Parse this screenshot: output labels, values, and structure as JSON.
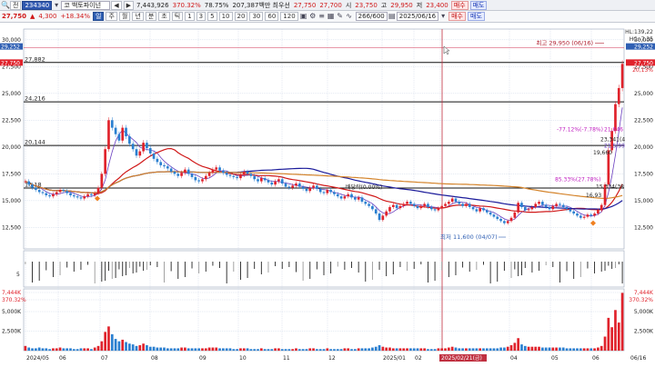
{
  "toolbar1": {
    "code_field": "",
    "code_value": "234340",
    "stock_name": "코 백토파이넌",
    "arrows": [
      "◀",
      "▶"
    ],
    "volume": "7,443,926",
    "vol_ratio": "370.32%",
    "turnover": "78.75%",
    "shares_info": "207,387백만 최우선",
    "bid1": "27,750",
    "bid2": "27,700",
    "open_label": "시",
    "open_value": "23,750",
    "high_label": "고",
    "high_value": "29,950",
    "low_label": "저",
    "low_value": "23,400",
    "buy_label": "매수",
    "sell_label": "매도"
  },
  "toolbar2": {
    "price": "27,750",
    "change_arrow": "▲",
    "change": "4,300",
    "change_pct": "+18.34%",
    "periods": [
      "주",
      "월",
      "년",
      "분",
      "초",
      "틱"
    ],
    "minutes": [
      "1",
      "3",
      "5",
      "10",
      "20",
      "30",
      "60",
      "120"
    ],
    "count": "266/600",
    "date": "2025/06/16",
    "buy_label": "매수",
    "sell_label": "매도"
  },
  "colors": {
    "up": "#e0222b",
    "down": "#2a7fd0",
    "ma5": "#6a3fc0",
    "ma20": "#d01818",
    "ma60": "#1a1a9a",
    "ma120": "#d4832a",
    "grid": "#c9d4e6",
    "level_line": "#111111",
    "cursor_line": "#c03040",
    "volume_bar": "#222222",
    "accent_blue": "#2f5fb3"
  },
  "chart_data": {
    "type": "candlestick",
    "y_axis_ticks": [
      "30,000",
      "27,500",
      "25,000",
      "22,500",
      "20,000",
      "17,500",
      "15,000",
      "12,500"
    ],
    "y_range": [
      10500,
      31000
    ],
    "x_axis_labels": [
      "2024/05",
      "06",
      "07",
      "08",
      "09",
      "10",
      "11",
      "12",
      "2025/01",
      "02",
      "2025/02/21(금)",
      "04",
      "05",
      "06",
      "06/16"
    ],
    "left_axis_tags": [
      "29,252",
      "27,750"
    ],
    "right_axis_tags": [
      "HL:139,22",
      "HC:-7.35",
      "29,252",
      "27,750",
      "20,13%"
    ],
    "left_levels": [
      "27,882",
      "24,216",
      "20,144",
      "16,18"
    ],
    "level_values": [
      27882,
      24216,
      20144,
      16180
    ],
    "annotations": {
      "high": "최고 29,950 (06/16)",
      "low": "최저 11,600 (04/07)",
      "pct1": "-77.12%(-7.78%)",
      "pct1_value": "21,646",
      "pct2": "85.33%(27.78%)",
      "pct2_value": "15,334(38",
      "mid1": "23,341(4",
      "mid2": "19,660",
      "mid3": "16,93",
      "mid4": "21,5.99",
      "mid_text": "배당락(0.00%)"
    },
    "sub1_axis": [
      "5"
    ],
    "sub2_axis_left": [
      "7,444K",
      "370.32%",
      "5,000K",
      "2,500K"
    ],
    "sub2_axis_right": [
      "7,444K",
      "370.32%",
      "5,000K",
      "2,500K"
    ],
    "price_series": [
      16800,
      16500,
      16200,
      16000,
      15800,
      15700,
      15500,
      15400,
      15600,
      15800,
      16000,
      15900,
      15700,
      15500,
      15400,
      15300,
      15200,
      15400,
      15600,
      15500,
      15700,
      16200,
      17500,
      19800,
      22500,
      21800,
      21200,
      20600,
      21800,
      21000,
      20300,
      19800,
      19200,
      19600,
      20400,
      19900,
      19400,
      18900,
      18600,
      18300,
      18200,
      18000,
      17700,
      17500,
      17300,
      17600,
      17900,
      17500,
      17200,
      16900,
      16800,
      17000,
      17300,
      17600,
      17900,
      18100,
      17800,
      17600,
      17400,
      17300,
      17200,
      17100,
      17400,
      17700,
      17500,
      17300,
      17000,
      16800,
      17100,
      16900,
      16700,
      16500,
      16800,
      17000,
      16600,
      16300,
      16200,
      16400,
      16600,
      16300,
      16100,
      15900,
      16200,
      16400,
      16100,
      15800,
      15700,
      16000,
      15800,
      15600,
      15400,
      15200,
      15400,
      15600,
      15300,
      15100,
      15300,
      14900,
      14700,
      14500,
      14200,
      13800,
      13200,
      13600,
      14000,
      14400,
      14600,
      14300,
      14500,
      14700,
      14900,
      14700,
      14500,
      14300,
      14500,
      14700,
      14400,
      14200,
      14100,
      14300,
      14500,
      14700,
      14900,
      15200,
      14900,
      14700,
      14500,
      14700,
      14400,
      14200,
      14000,
      14300,
      14100,
      13900,
      13700,
      13500,
      13300,
      13100,
      12900,
      13100,
      13400,
      13900,
      14800,
      14400,
      14100,
      14200,
      14400,
      14700,
      14900,
      14600,
      14400,
      14200,
      14500,
      14700,
      14600,
      14400,
      14200,
      14000,
      13800,
      13600,
      13400,
      13500,
      13700,
      13600,
      13800,
      14100,
      14600,
      16500,
      19700,
      21500,
      24000,
      25500,
      27750
    ],
    "volume_series": [
      0.6,
      0.4,
      0.3,
      0.3,
      0.4,
      0.3,
      0.3,
      0.2,
      0.3,
      0.3,
      0.4,
      0.3,
      0.3,
      0.3,
      0.2,
      0.2,
      0.3,
      0.3,
      0.3,
      0.2,
      0.4,
      0.6,
      1.2,
      2.4,
      3.1,
      2.1,
      1.5,
      1.2,
      1.4,
      1.1,
      0.9,
      0.8,
      0.6,
      0.7,
      0.9,
      0.7,
      0.5,
      0.5,
      0.4,
      0.4,
      0.4,
      0.3,
      0.3,
      0.3,
      0.3,
      0.4,
      0.4,
      0.3,
      0.3,
      0.3,
      0.3,
      0.3,
      0.3,
      0.4,
      0.4,
      0.4,
      0.3,
      0.3,
      0.3,
      0.3,
      0.2,
      0.2,
      0.3,
      0.3,
      0.3,
      0.2,
      0.2,
      0.2,
      0.3,
      0.2,
      0.2,
      0.2,
      0.3,
      0.3,
      0.2,
      0.2,
      0.2,
      0.2,
      0.3,
      0.2,
      0.2,
      0.2,
      0.3,
      0.3,
      0.2,
      0.2,
      0.2,
      0.3,
      0.2,
      0.2,
      0.2,
      0.2,
      0.3,
      0.3,
      0.2,
      0.2,
      0.3,
      0.3,
      0.3,
      0.3,
      0.4,
      0.5,
      0.7,
      0.5,
      0.4,
      0.4,
      0.3,
      0.3,
      0.3,
      0.3,
      0.3,
      0.3,
      0.3,
      0.3,
      0.3,
      0.3,
      0.2,
      0.2,
      0.2,
      0.3,
      0.3,
      0.3,
      0.4,
      0.5,
      0.4,
      0.3,
      0.3,
      0.3,
      0.3,
      0.3,
      0.3,
      0.3,
      0.3,
      0.3,
      0.3,
      0.3,
      0.3,
      0.4,
      0.4,
      0.5,
      0.7,
      1.0,
      1.6,
      0.8,
      0.6,
      0.5,
      0.5,
      0.5,
      0.5,
      0.4,
      0.4,
      0.4,
      0.4,
      0.4,
      0.4,
      0.4,
      0.3,
      0.3,
      0.3,
      0.3,
      0.3,
      0.3,
      0.3,
      0.3,
      0.3,
      0.4,
      0.6,
      1.8,
      4.2,
      3.0,
      5.2,
      3.6,
      7.4
    ]
  }
}
